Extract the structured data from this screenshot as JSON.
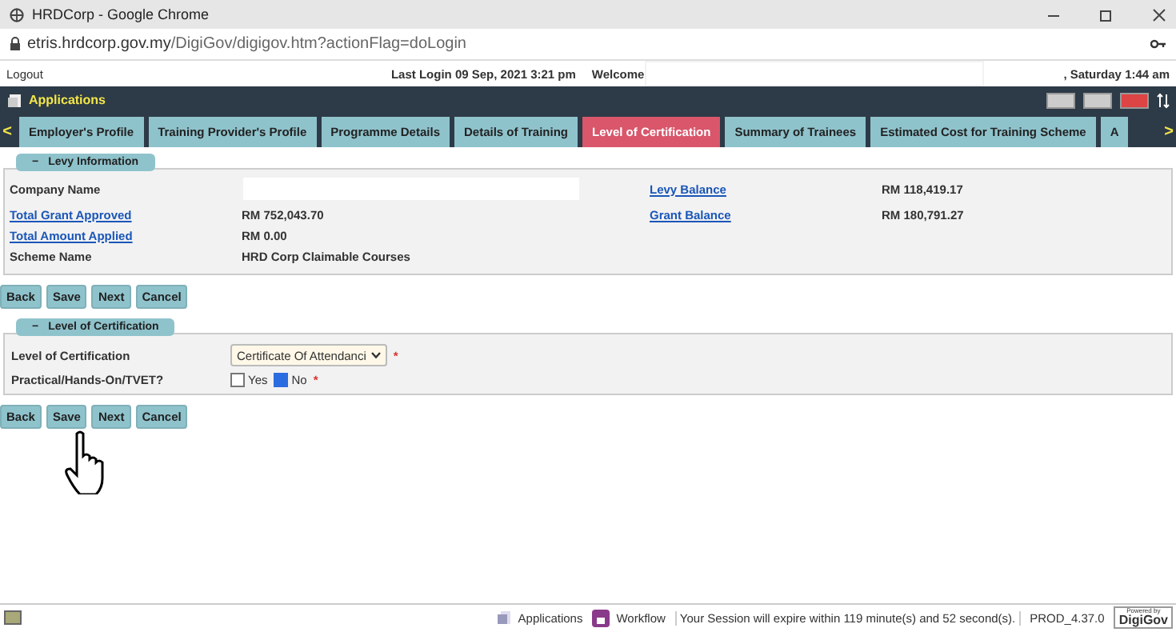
{
  "window": {
    "title": "HRDCorp - Google Chrome",
    "url_host": "etris.hrdcorp.gov.my",
    "url_path": "/DigiGov/digigov.htm?actionFlag=doLogin"
  },
  "header": {
    "logout": "Logout",
    "last_login": "Last Login 09 Sep, 2021 3:21 pm",
    "welcome": "Welcome",
    "date": ", Saturday 1:44 am"
  },
  "app_bar": {
    "title": "Applications"
  },
  "tabs": {
    "prev": "<",
    "next": ">",
    "items": [
      {
        "label": "Employer's Profile",
        "selected": false
      },
      {
        "label": "Training Provider's Profile",
        "selected": false
      },
      {
        "label": "Programme Details",
        "selected": false
      },
      {
        "label": "Details of Training",
        "selected": false
      },
      {
        "label": "Level of Certification",
        "selected": true
      },
      {
        "label": "Summary of Trainees",
        "selected": false
      },
      {
        "label": "Estimated Cost for Training Scheme",
        "selected": false
      },
      {
        "label": "A",
        "selected": false
      }
    ]
  },
  "levy": {
    "title": "Levy Information",
    "collapse": "−",
    "rows": [
      {
        "label": "Company Name",
        "link": false,
        "value": "",
        "label2": "Levy Balance",
        "value2": "RM 118,419.17"
      },
      {
        "label": "Total Grant Approved",
        "link": true,
        "value": "RM 752,043.70",
        "label2": "Grant Balance",
        "value2": "RM 180,791.27"
      },
      {
        "label": "Total Amount Applied",
        "link": true,
        "value": "RM 0.00"
      },
      {
        "label": "Scheme Name",
        "link": false,
        "value": "HRD Corp Claimable Courses"
      }
    ]
  },
  "buttons_top": [
    "Back",
    "Save",
    "Next",
    "Cancel"
  ],
  "certification": {
    "title": "Level of Certification",
    "collapse": "−",
    "level_label": "Level of Certification",
    "level_value": "Certificate Of Attendanci",
    "required": "*",
    "practical_label": "Practical/Hands-On/TVET?",
    "options": [
      {
        "label": "Yes",
        "selected": false
      },
      {
        "label": "No",
        "selected": true
      }
    ]
  },
  "buttons_bottom": [
    "Back",
    "Save",
    "Next",
    "Cancel"
  ],
  "status_bar": {
    "applications": "Applications",
    "workflow": "Workflow",
    "session": "Your Session will expire within 119 minute(s) and 52 second(s).",
    "version": "PROD_4.37.0",
    "badge_top": "Powered by",
    "badge": "DigiGov"
  }
}
